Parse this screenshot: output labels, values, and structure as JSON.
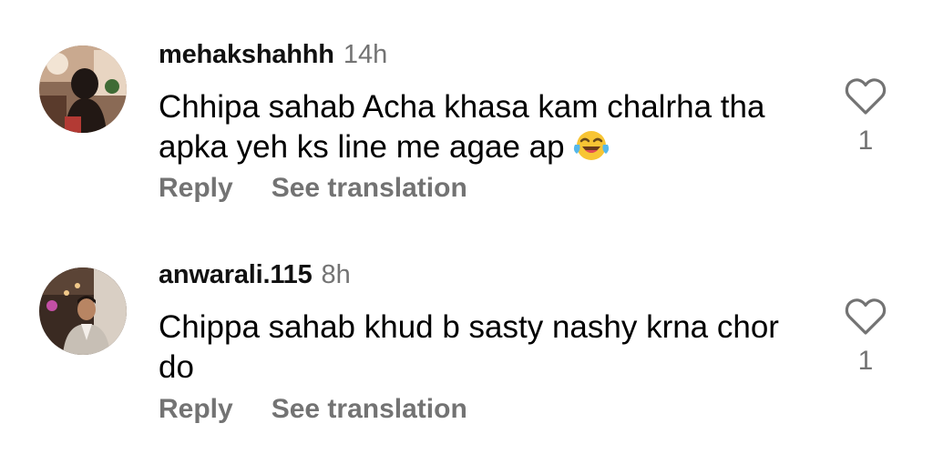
{
  "comments": [
    {
      "username": "mehakshahhh",
      "time": "14h",
      "text": "Chhipa sahab Acha khasa kam chalrha tha apka yeh ks line me agae ap",
      "emoji": "face-with-tears-of-joy",
      "reply_label": "Reply",
      "translate_label": "See translation",
      "like_count": "1",
      "icons": {
        "like": "heart-outline-icon"
      }
    },
    {
      "username": "anwarali.115",
      "time": "8h",
      "text": "Chippa sahab khud b sasty nashy krna chor do",
      "reply_label": "Reply",
      "translate_label": "See translation",
      "like_count": "1",
      "icons": {
        "like": "heart-outline-icon"
      }
    }
  ],
  "colors": {
    "text": "#000000",
    "secondary": "#737373",
    "background": "#ffffff"
  }
}
